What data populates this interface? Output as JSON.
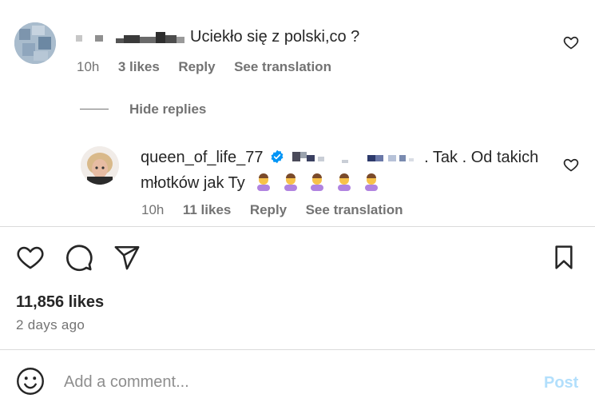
{
  "comment": {
    "text": "Uciekło się z polski,co ?",
    "time": "10h",
    "likes": "3 likes",
    "reply": "Reply",
    "translation": "See translation"
  },
  "replies_toggle": "Hide replies",
  "reply": {
    "username": "queen_of_life_77",
    "text_line1": ". Tak . Od takich",
    "text_line2": "młotków jak Ty",
    "time": "10h",
    "likes": "11 likes",
    "reply": "Reply",
    "translation": "See translation"
  },
  "post": {
    "likes": "11,856 likes",
    "date": "2 days ago"
  },
  "composer": {
    "placeholder": "Add a comment...",
    "post_label": "Post"
  },
  "colors": {
    "meta": "#737373",
    "verified": "#0095f6",
    "post_disabled": "#b2dffc",
    "divider": "#dbdbdb"
  }
}
